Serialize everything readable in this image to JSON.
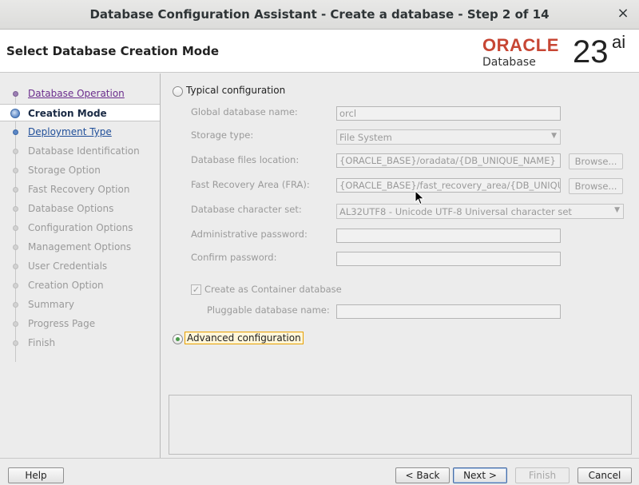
{
  "window": {
    "title": "Database Configuration Assistant - Create a database - Step 2 of 14",
    "close_icon": "×"
  },
  "header": {
    "page_title": "Select Database Creation Mode",
    "logo": {
      "brand": "ORACLE",
      "product": "Database",
      "version": "23",
      "suffix": "ai"
    }
  },
  "nav": {
    "items": [
      {
        "label": "Database Operation",
        "state": "done"
      },
      {
        "label": "Creation Mode",
        "state": "current"
      },
      {
        "label": "Deployment Type",
        "state": "link"
      },
      {
        "label": "Database Identification",
        "state": "disabled"
      },
      {
        "label": "Storage Option",
        "state": "disabled"
      },
      {
        "label": "Fast Recovery Option",
        "state": "disabled"
      },
      {
        "label": "Database Options",
        "state": "disabled"
      },
      {
        "label": "Configuration Options",
        "state": "disabled"
      },
      {
        "label": "Management Options",
        "state": "disabled"
      },
      {
        "label": "User Credentials",
        "state": "disabled"
      },
      {
        "label": "Creation Option",
        "state": "disabled"
      },
      {
        "label": "Summary",
        "state": "disabled"
      },
      {
        "label": "Progress Page",
        "state": "disabled"
      },
      {
        "label": "Finish",
        "state": "disabled"
      }
    ]
  },
  "form": {
    "typical_label": "Typical configuration",
    "typical_selected": false,
    "global_db_name_label": "Global database name:",
    "global_db_name_value": "orcl",
    "storage_type_label": "Storage type:",
    "storage_type_value": "File System",
    "db_files_location_label": "Database files location:",
    "db_files_location_value": "{ORACLE_BASE}/oradata/{DB_UNIQUE_NAME}",
    "fra_label": "Fast Recovery Area (FRA):",
    "fra_value": "{ORACLE_BASE}/fast_recovery_area/{DB_UNIQU",
    "charset_label": "Database character set:",
    "charset_value": "AL32UTF8 - Unicode UTF-8 Universal character set",
    "admin_password_label": "Administrative password:",
    "admin_password_value": "",
    "confirm_password_label": "Confirm password:",
    "confirm_password_value": "",
    "container_label": "Create as Container database",
    "container_checked": true,
    "pdb_name_label": "Pluggable database name:",
    "pdb_name_value": "",
    "browse_label": "Browse...",
    "advanced_label": "Advanced configuration",
    "advanced_selected": true
  },
  "footer": {
    "help": "Help",
    "back": "< Back",
    "next": "Next >",
    "finish": "Finish",
    "cancel": "Cancel"
  }
}
